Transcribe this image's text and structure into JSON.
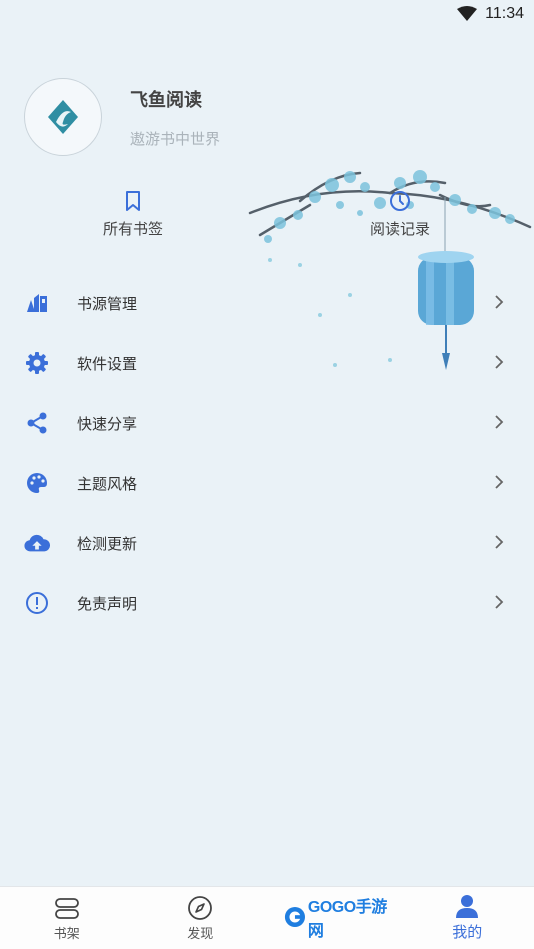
{
  "status": {
    "time": "11:34"
  },
  "profile": {
    "app_name": "飞鱼阅读",
    "slogan": "遨游书中世界"
  },
  "quick_links": [
    {
      "label": "所有书签",
      "icon": "bookmark-icon"
    },
    {
      "label": "阅读记录",
      "icon": "clock-icon"
    }
  ],
  "menu": [
    {
      "label": "书源管理",
      "icon": "source-icon"
    },
    {
      "label": "软件设置",
      "icon": "gear-icon"
    },
    {
      "label": "快速分享",
      "icon": "share-icon"
    },
    {
      "label": "主题风格",
      "icon": "palette-icon"
    },
    {
      "label": "检测更新",
      "icon": "cloud-upload-icon"
    },
    {
      "label": "免责声明",
      "icon": "alert-circle-icon"
    }
  ],
  "bottom_nav": [
    {
      "label": "书架",
      "icon": "bookshelf-icon"
    },
    {
      "label": "发现",
      "icon": "compass-icon"
    },
    {
      "label": "",
      "icon": "watermark-logo"
    },
    {
      "label": "我的",
      "icon": "person-icon",
      "active": true
    }
  ],
  "watermark": {
    "text": "GOGO手游网"
  },
  "colors": {
    "accent": "#3b6fd9",
    "background": "#eaf2f7",
    "decor": "#6fb8d6"
  }
}
